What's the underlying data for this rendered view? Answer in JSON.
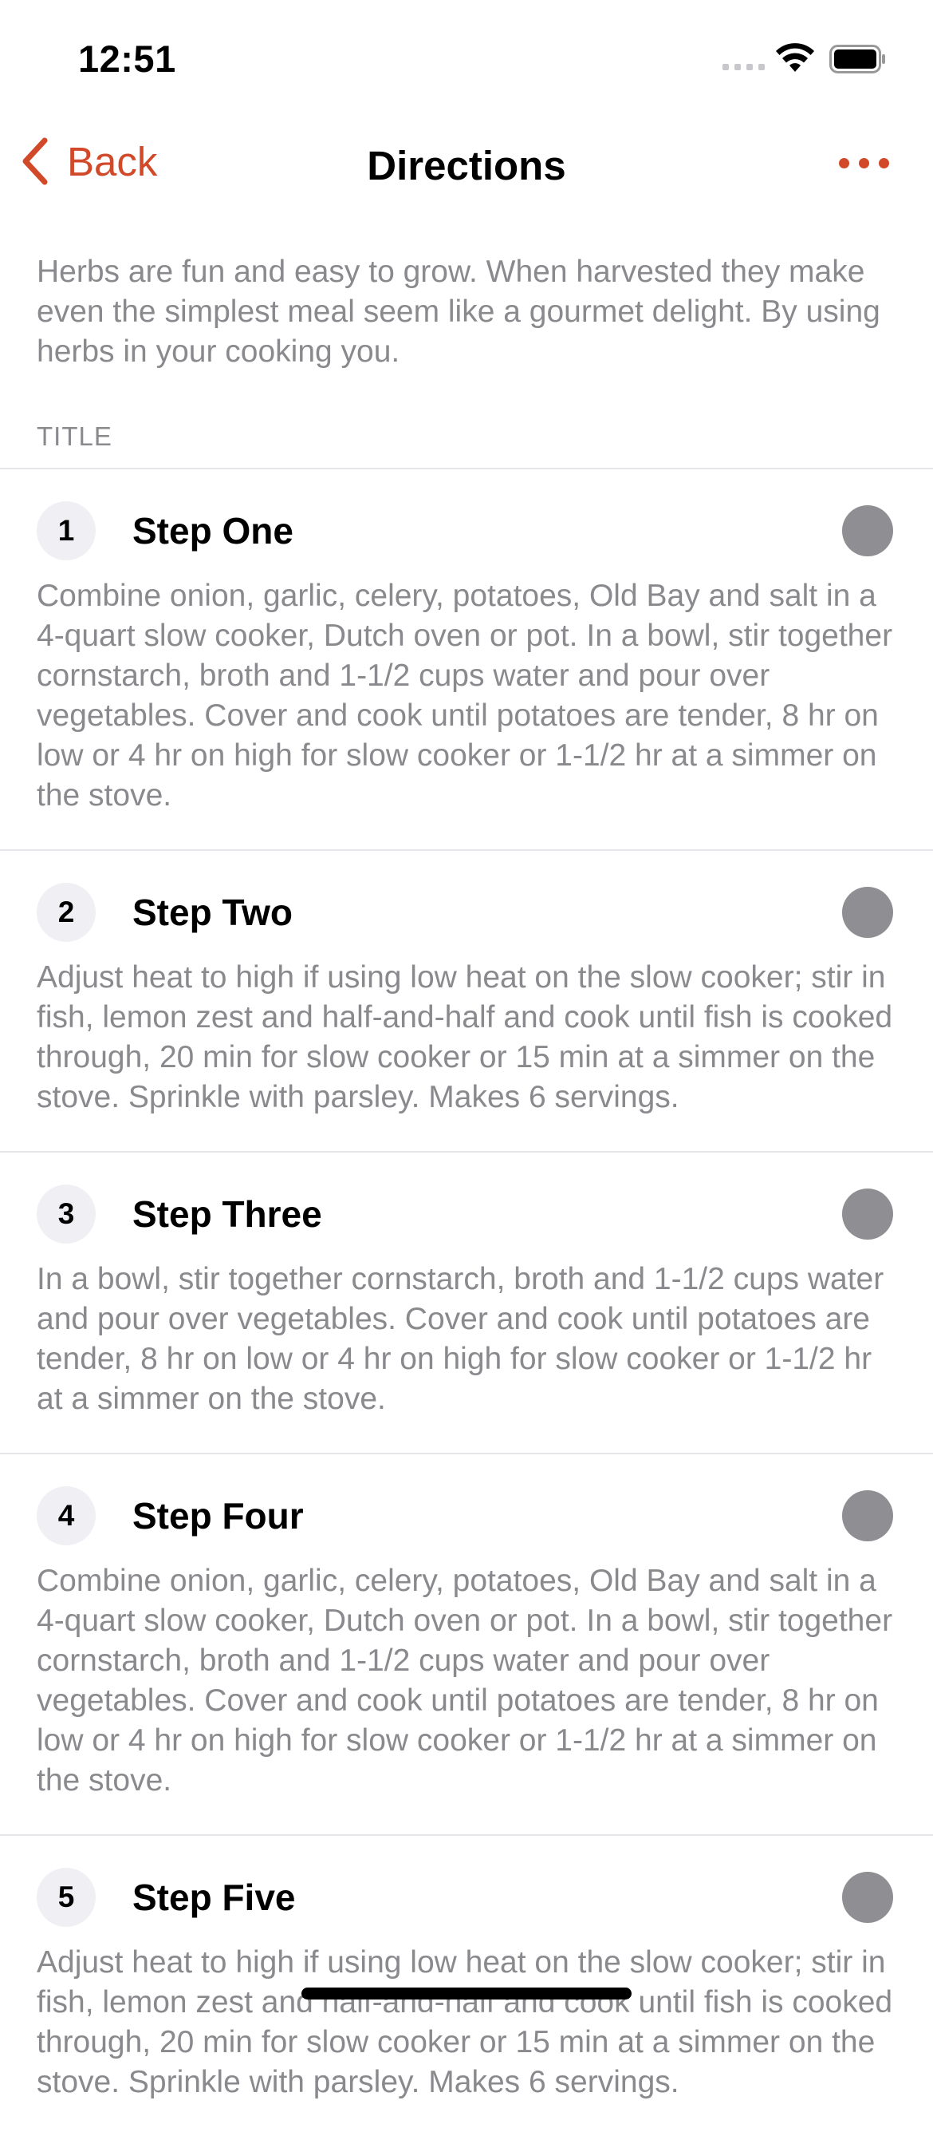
{
  "status_bar": {
    "time": "12:51"
  },
  "nav": {
    "back_label": "Back",
    "title": "Directions"
  },
  "intro": "Herbs are fun and easy to grow. When harvested they make even the simplest meal seem like a gourmet delight. By using herbs in your cooking you.",
  "section_header": "TITLE",
  "steps": [
    {
      "number": "1",
      "title": "Step One",
      "body": "Combine onion, garlic, celery, potatoes, Old Bay and salt in a 4-quart slow cooker, Dutch oven or pot. In a bowl, stir together cornstarch, broth and 1-1/2 cups water and pour over vegetables. Cover and cook until potatoes are tender, 8 hr on low or 4 hr on high for slow cooker or 1-1/2 hr at a simmer on the stove."
    },
    {
      "number": "2",
      "title": "Step Two",
      "body": "Adjust heat to high if using low heat on the slow cooker; stir in fish, lemon zest and half-and-half and cook until fish is cooked through, 20 min for slow cooker or 15 min at a simmer on the stove. Sprinkle with parsley. Makes 6 servings."
    },
    {
      "number": "3",
      "title": "Step Three",
      "body": "In a bowl, stir together cornstarch, broth and 1-1/2 cups water and pour over vegetables. Cover and cook until potatoes are tender, 8 hr on low or 4 hr on high for slow cooker or 1-1/2 hr at a simmer on the stove."
    },
    {
      "number": "4",
      "title": "Step Four",
      "body": "Combine onion, garlic, celery, potatoes, Old Bay and salt in a 4-quart slow cooker, Dutch oven or pot. In a bowl, stir together cornstarch, broth and 1-1/2 cups water and pour over vegetables. Cover and cook until potatoes are tender, 8 hr on low or 4 hr on high for slow cooker or 1-1/2 hr at a simmer on the stove."
    },
    {
      "number": "5",
      "title": "Step Five",
      "body": "Adjust heat to high if using low heat on the slow cooker; stir in fish, lemon zest and half-and-half and cook until fish is cooked through, 20 min for slow cooker or 15 min at a simmer on the stove. Sprinkle with parsley. Makes 6 servings."
    }
  ],
  "colors": {
    "accent": "#d2492a",
    "secondary_text": "#8a8a8e",
    "check": "#8e8e93"
  }
}
